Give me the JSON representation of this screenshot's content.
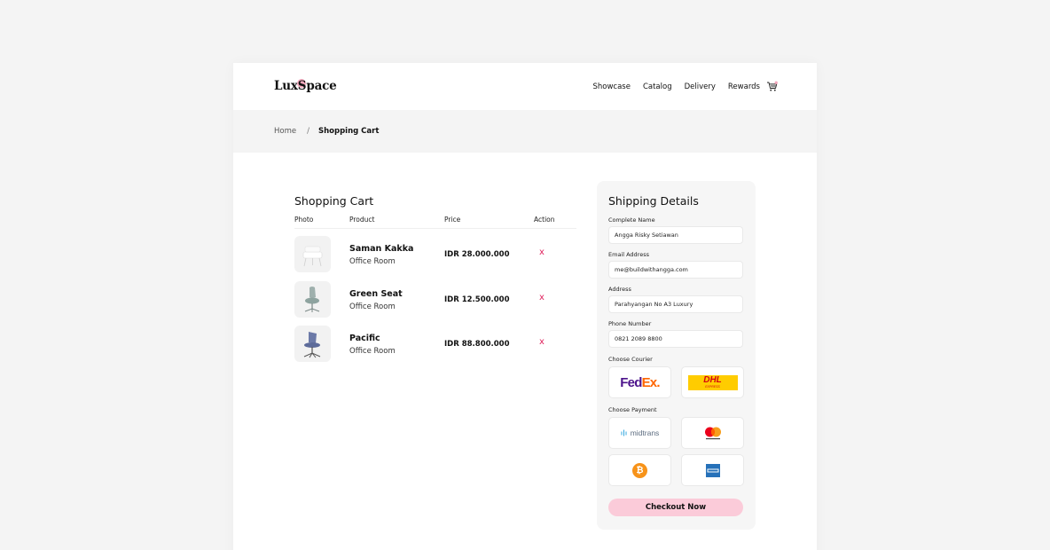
{
  "brand": {
    "name_part1": "Lux",
    "name_part2": "S",
    "name_part3": "pace",
    "accent": "#f3a8bd"
  },
  "nav": {
    "items": [
      {
        "label": "Showcase"
      },
      {
        "label": "Catalog"
      },
      {
        "label": "Delivery"
      },
      {
        "label": "Rewards"
      }
    ],
    "cart_icon": "cart-icon"
  },
  "breadcrumb": {
    "home": "Home",
    "separator": "/",
    "current": "Shopping Cart"
  },
  "cart": {
    "title": "Shopping Cart",
    "columns": {
      "photo": "Photo",
      "product": "Product",
      "price": "Price",
      "action": "Action"
    },
    "items": [
      {
        "name": "Saman Kakka",
        "category": "Office Room",
        "price": "IDR 28.000.000",
        "remove": "x"
      },
      {
        "name": "Green Seat",
        "category": "Office Room",
        "price": "IDR 12.500.000",
        "remove": "x"
      },
      {
        "name": "Pacific",
        "category": "Office Room",
        "price": "IDR 88.800.000",
        "remove": "x"
      }
    ]
  },
  "shipping": {
    "title": "Shipping Details",
    "fields": {
      "name": {
        "label": "Complete Name",
        "value": "Angga Risky Setiawan"
      },
      "email": {
        "label": "Email Address",
        "value": "me@buildwithangga.com"
      },
      "address": {
        "label": "Address",
        "value": "Parahyangan No A3 Luxury"
      },
      "phone": {
        "label": "Phone Number",
        "value": "0821 2089 8800"
      }
    },
    "courier_label": "Choose Courier",
    "couriers": {
      "fedex_a": "Fed",
      "fedex_b": "Ex",
      "dhl": "DHL",
      "dhl_sub": "EXPRESS"
    },
    "payment_label": "Choose Payment",
    "payments": {
      "midtrans": "midtrans",
      "bitcoin": "₿"
    },
    "checkout_label": "Checkout Now",
    "checkout_color": "#fbcbd9",
    "remove_color": "#e0245e"
  }
}
